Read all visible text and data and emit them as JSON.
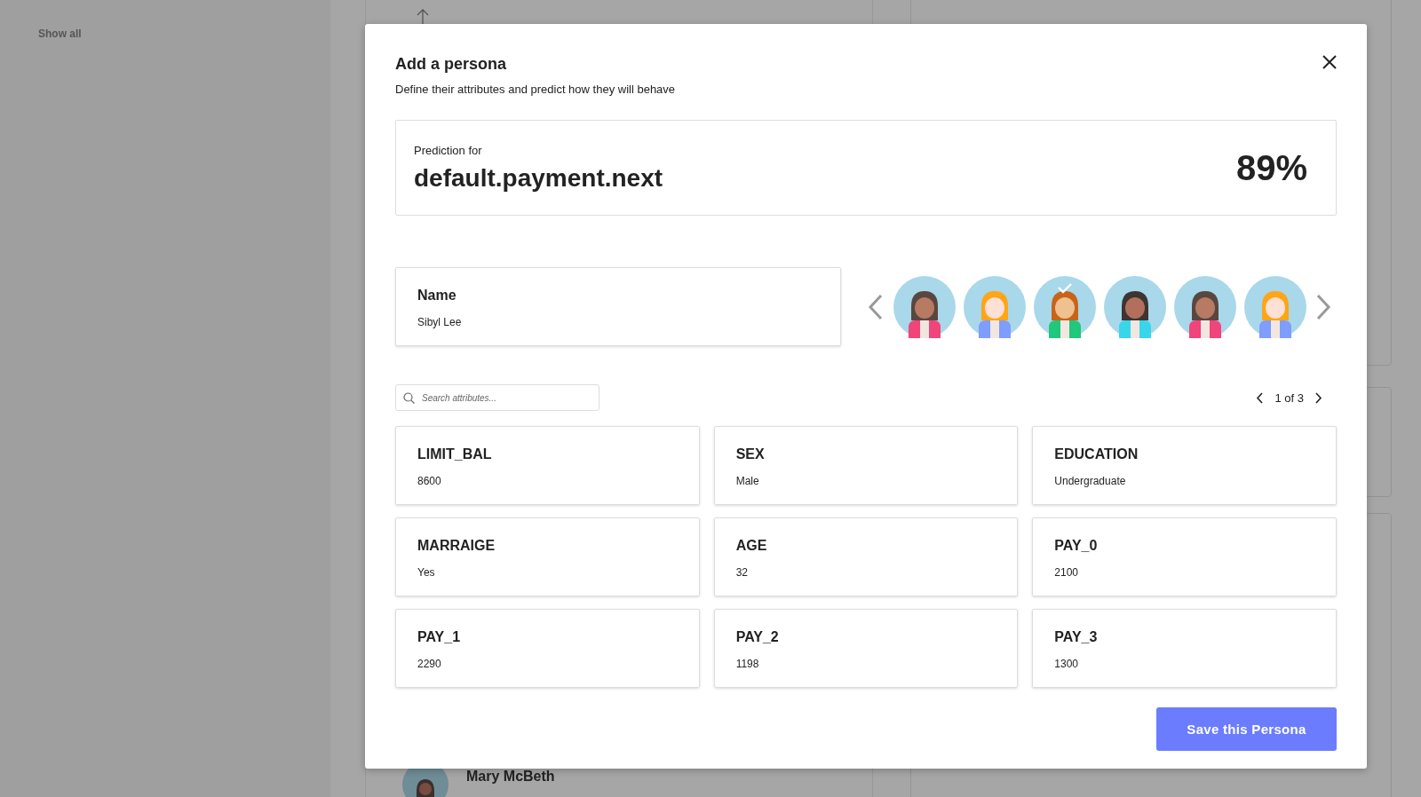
{
  "sidebar": {
    "link": "Show all"
  },
  "background_card": {
    "name": "Mary McBeth"
  },
  "dialog": {
    "title": "Add a persona",
    "subtitle": "Define their attributes and predict how they will behave",
    "prediction": {
      "label": "Prediction for",
      "target": "default.payment.next",
      "value": "89%"
    },
    "name_field": {
      "label": "Name",
      "value": "Sibyl Lee"
    },
    "avatars": [
      {
        "selected": false
      },
      {
        "selected": false
      },
      {
        "selected": true
      },
      {
        "selected": false
      },
      {
        "selected": false
      },
      {
        "selected": false
      }
    ],
    "search": {
      "placeholder": "Search attributes..."
    },
    "pager": "1 of 3",
    "attributes": [
      {
        "name": "LIMIT_BAL",
        "value": "8600"
      },
      {
        "name": "SEX",
        "value": "Male"
      },
      {
        "name": "EDUCATION",
        "value": "Undergraduate"
      },
      {
        "name": "MARRAIGE",
        "value": "Yes"
      },
      {
        "name": "AGE",
        "value": "32"
      },
      {
        "name": "PAY_0",
        "value": "2100"
      },
      {
        "name": "PAY_1",
        "value": "2290"
      },
      {
        "name": "PAY_2",
        "value": "1198"
      },
      {
        "name": "PAY_3",
        "value": "1300"
      }
    ],
    "save_button": "Save this Persona"
  }
}
